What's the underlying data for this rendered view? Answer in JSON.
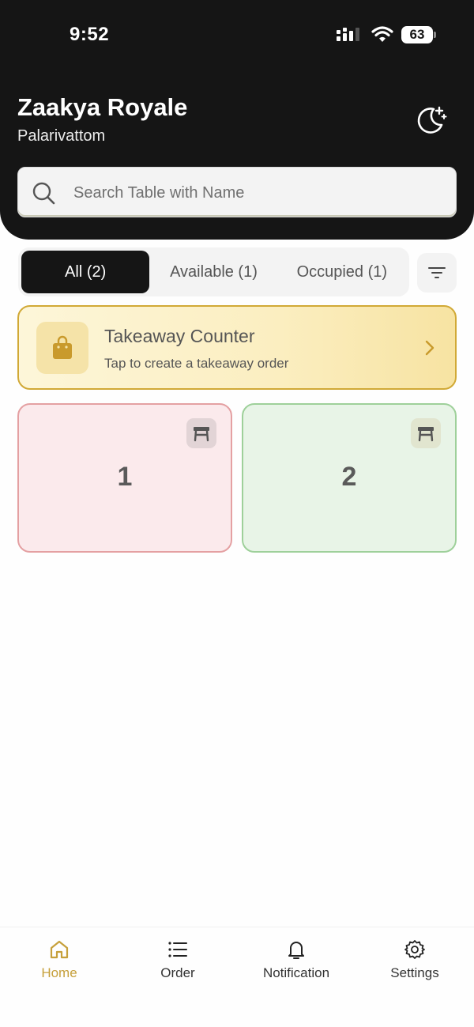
{
  "status_bar": {
    "time": "9:52",
    "battery": "63"
  },
  "header": {
    "restaurant_name": "Zaakya Royale",
    "location": "Palarivattom"
  },
  "search": {
    "placeholder": "Search Table with Name",
    "value": ""
  },
  "tabs": [
    {
      "label": "All (2)",
      "active": true
    },
    {
      "label": "Available (1)",
      "active": false
    },
    {
      "label": "Occupied (1)",
      "active": false
    }
  ],
  "takeaway": {
    "title": "Takeaway Counter",
    "subtitle": "Tap to create a takeaway order"
  },
  "tables": [
    {
      "number": "1",
      "status": "occupied"
    },
    {
      "number": "2",
      "status": "available"
    }
  ],
  "bottom_nav": [
    {
      "label": "Home",
      "icon": "home-icon",
      "active": true
    },
    {
      "label": "Order",
      "icon": "list-icon",
      "active": false
    },
    {
      "label": "Notification",
      "icon": "bell-icon",
      "active": false
    },
    {
      "label": "Settings",
      "icon": "gear-icon",
      "active": false
    }
  ],
  "colors": {
    "header_bg": "#151515",
    "accent_gold": "#c6a03b",
    "occupied_bg": "#fbeaec",
    "occupied_border": "#e4a0a2",
    "available_bg": "#e8f4e7",
    "available_border": "#9ed09a"
  }
}
